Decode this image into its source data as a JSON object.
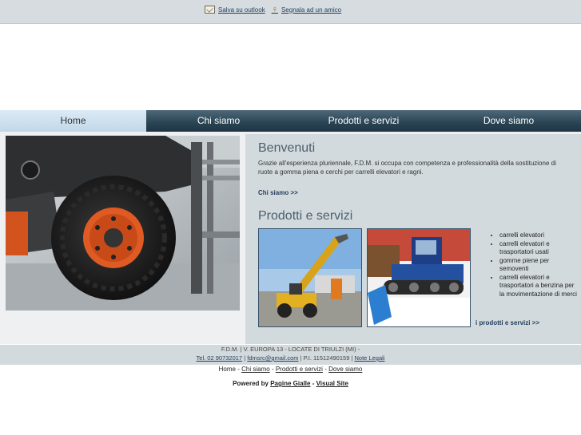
{
  "topbar": {
    "outlook_link": "Salva su outlook",
    "friend_link": "Segnala ad un amico",
    "outlook_icon": "address-card-icon",
    "friend_icon": "person-link-icon"
  },
  "nav": {
    "items": [
      "Home",
      "Chi siamo",
      "Prodotti e servizi",
      "Dove siamo"
    ],
    "active": "Home"
  },
  "welcome": {
    "title": "Benvenuti",
    "text": "Grazie all'esperienza pluriennale, F.D.M. si occupa con competenza e professionalità della sostituzione di ruote a gomma piena e cerchi per carrelli elevatori e ragni.",
    "more_link": "Chi siamo >>"
  },
  "products": {
    "title": "Prodotti e servizi",
    "list": [
      "carrelli elevatori",
      "carrelli elevatori e trasportatori usati",
      "gomme piene per semoventi",
      "carrelli elevatori e trasportatori a benzina per la movimentazione di merci"
    ],
    "more_link": "i prodotti e servizi >>"
  },
  "footer": {
    "line1": "F.D.M. | V. EUROPA 13 - LOCATE DI TRIULZI (MI) -",
    "phone": "Tel. 02 90732017",
    "email": "fdmsrc@gmail.com",
    "piva": "| P.I. 11512490159 |",
    "legal": "Note Legali"
  },
  "bottom_nav": {
    "home": "Home",
    "chi_siamo": "Chi siamo",
    "prodotti": "Prodotti e servizi",
    "dove": "Dove siamo"
  },
  "powered": {
    "label": "Powered by",
    "pagine_gialle": "Pagine Gialle",
    "visual_site": "Visual Site"
  },
  "colors": {
    "nav_dark": "#2c4656",
    "nav_active": "#c9dced",
    "panel_bg": "#d3dadd",
    "accent_link": "#1f3b5a"
  }
}
